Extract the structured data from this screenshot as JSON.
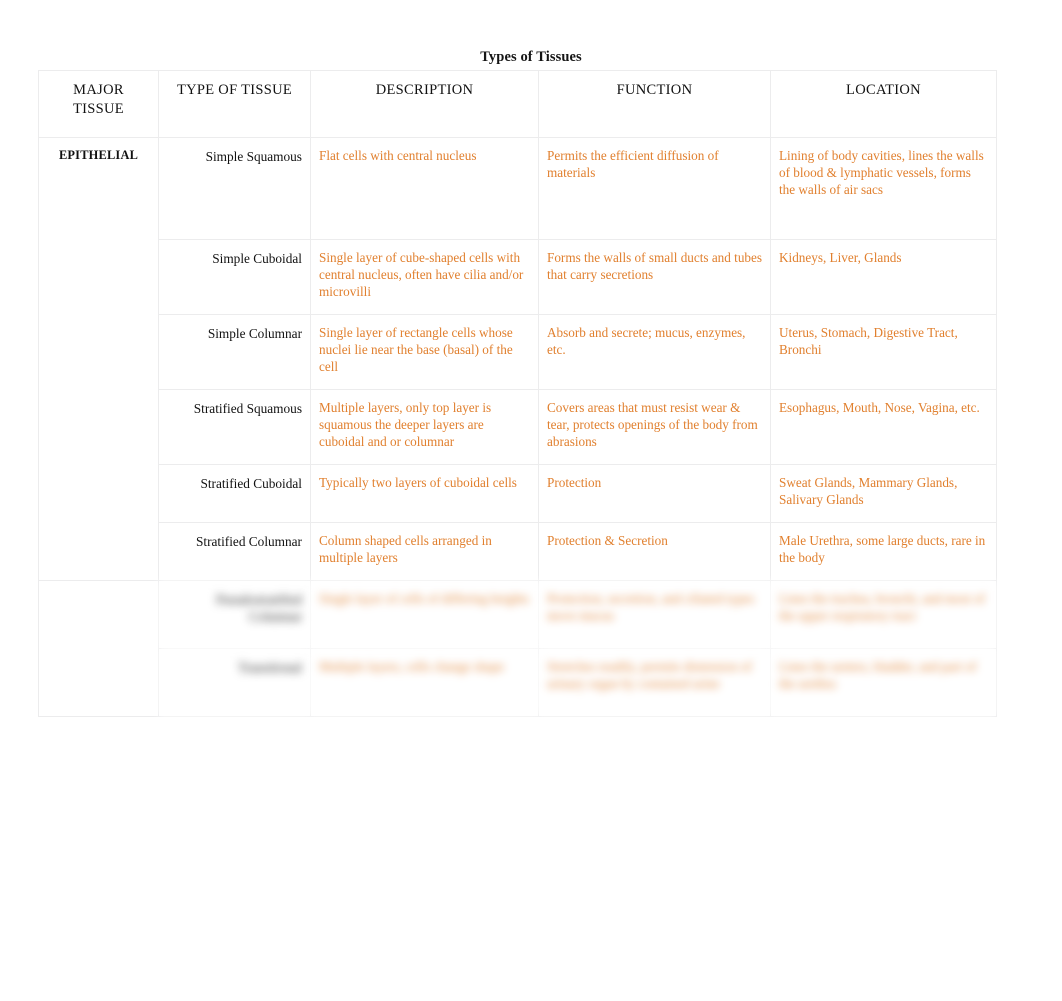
{
  "document": {
    "title": "Types of Tissues"
  },
  "table": {
    "headers": [
      "MAJOR TISSUE",
      "TYPE OF TISSUE",
      "DESCRIPTION",
      "FUNCTION",
      "LOCATION"
    ],
    "header_major_line1": "MAJOR",
    "header_major_line2": "TISSUE",
    "major_tissue_group": "EPITHELIAL",
    "accent_color": "#e1802f",
    "header_text_color": "#111111",
    "border_color": "#ececed",
    "rows": [
      {
        "type": "Simple Squamous",
        "description": "Flat cells with central nucleus",
        "function": "Permits the efficient diffusion of materials",
        "location": "Lining of body cavities, lines the walls of blood & lymphatic vessels, forms the walls of air sacs",
        "blurred": false
      },
      {
        "type": "Simple Cuboidal",
        "description": "Single layer of cube-shaped cells with central nucleus, often have cilia and/or microvilli",
        "function": "Forms the walls of small ducts and tubes that carry secretions",
        "location": "Kidneys, Liver, Glands",
        "blurred": false
      },
      {
        "type": "Simple Columnar",
        "description": "Single layer of rectangle cells whose nuclei lie near the base (basal) of the cell",
        "function": "Absorb and secrete; mucus, enzymes, etc.",
        "location": "Uterus, Stomach, Digestive Tract, Bronchi",
        "blurred": false
      },
      {
        "type": "Stratified Squamous",
        "description": "Multiple layers, only top layer is squamous the deeper layers are cuboidal and or columnar",
        "function": "Covers areas that must resist wear & tear, protects openings of the body from abrasions",
        "location": "Esophagus, Mouth, Nose, Vagina, etc.",
        "blurred": false
      },
      {
        "type": "Stratified Cuboidal",
        "description": "Typically two layers of cuboidal cells",
        "function": "Protection",
        "location": "Sweat Glands, Mammary Glands, Salivary Glands",
        "blurred": false
      },
      {
        "type": "Stratified Columnar",
        "description": "Column shaped cells arranged in multiple layers",
        "function": "Protection & Secretion",
        "location": "Male Urethra, some large ducts, rare in the body",
        "blurred": false
      },
      {
        "type": "Pseudostratified Columnar",
        "description": "Single layer of cells of differing heights",
        "function": "Protection, secretion, and ciliated types move mucus",
        "location": "Lines the trachea, bronchi, and most of the upper respiratory tract",
        "blurred": true
      },
      {
        "type": "Transitional",
        "description": "Multiple layers, cells change shape",
        "function": "Stretches readily, permits distension of urinary organ by contained urine",
        "location": "Lines the ureters, bladder, and part of the urethra",
        "blurred": true
      }
    ]
  }
}
